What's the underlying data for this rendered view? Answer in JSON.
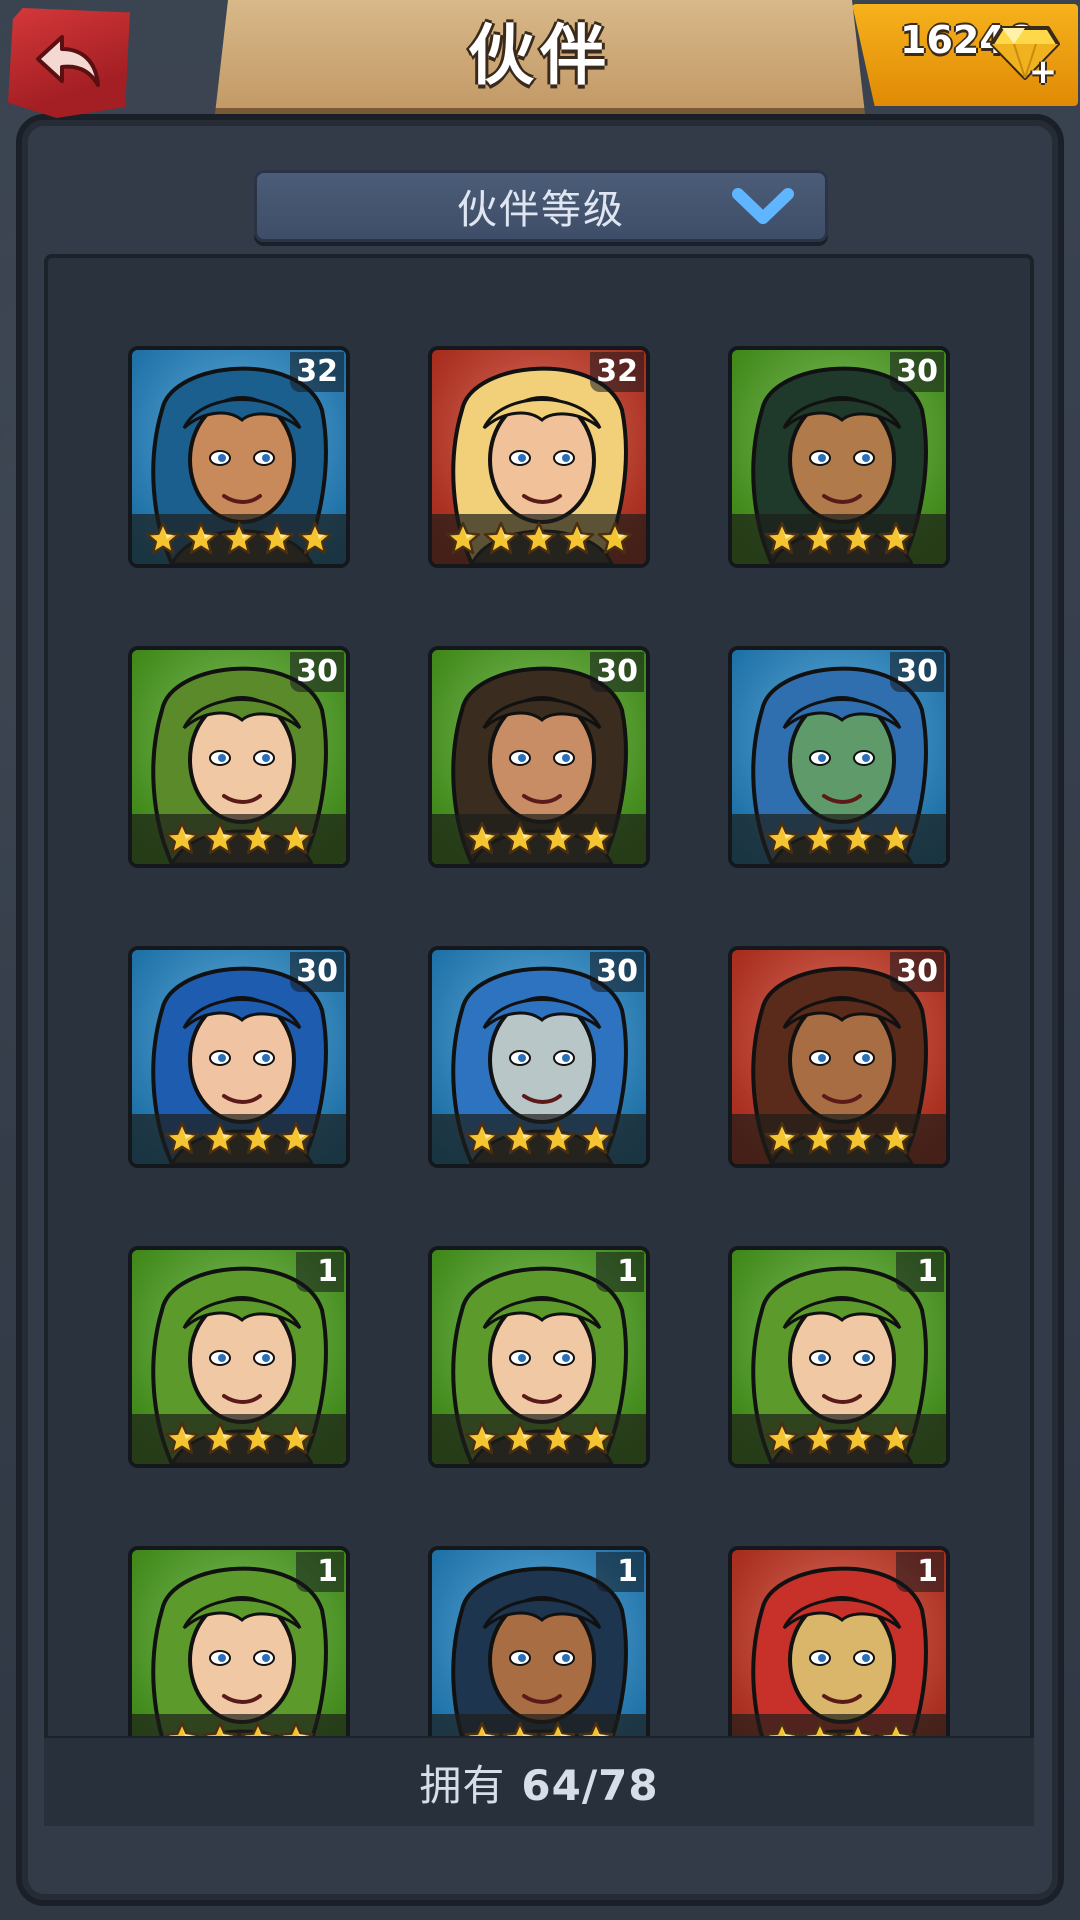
{
  "header": {
    "title": "伙伴",
    "gems": "16246",
    "gem_plus": "+"
  },
  "sort": {
    "label": "伙伴等级"
  },
  "colors": {
    "blue": "#1e8fd8",
    "red": "#d8321c",
    "green": "#4cae18",
    "star": "#f5c431",
    "panel": "#2a323d"
  },
  "companions": [
    {
      "level": "32",
      "stars": 5,
      "bg": "blue",
      "skin": "#c88a5a",
      "hair": "#1b5f8f"
    },
    {
      "level": "32",
      "stars": 5,
      "bg": "red",
      "skin": "#f1c299",
      "hair": "#f2d07a"
    },
    {
      "level": "30",
      "stars": 4,
      "bg": "green",
      "skin": "#b07a4a",
      "hair": "#1f3a2a"
    },
    {
      "level": "30",
      "stars": 4,
      "bg": "green",
      "skin": "#f1c8a4",
      "hair": "#5b8a2a"
    },
    {
      "level": "30",
      "stars": 4,
      "bg": "green",
      "skin": "#c98d66",
      "hair": "#3a2c1e"
    },
    {
      "level": "30",
      "stars": 4,
      "bg": "blue",
      "skin": "#5f9a6a",
      "hair": "#2f6fb0"
    },
    {
      "level": "30",
      "stars": 4,
      "bg": "blue",
      "skin": "#f0c3a3",
      "hair": "#1e5cb0"
    },
    {
      "level": "30",
      "stars": 4,
      "bg": "blue",
      "skin": "#b9c6c8",
      "hair": "#2e73c0"
    },
    {
      "level": "30",
      "stars": 4,
      "bg": "red",
      "skin": "#a86d43",
      "hair": "#5a2a1a"
    },
    {
      "level": "1",
      "stars": 4,
      "bg": "green",
      "skin": "#f0c8a4",
      "hair": "#5c9a2c"
    },
    {
      "level": "1",
      "stars": 4,
      "bg": "green",
      "skin": "#f0c8a4",
      "hair": "#5c9a2c"
    },
    {
      "level": "1",
      "stars": 4,
      "bg": "green",
      "skin": "#f0c8a4",
      "hair": "#5c9a2c"
    },
    {
      "level": "1",
      "stars": 4,
      "bg": "green",
      "skin": "#f0c8a4",
      "hair": "#5c9a2c"
    },
    {
      "level": "1",
      "stars": 4,
      "bg": "blue",
      "skin": "#a86d43",
      "hair": "#1e3550"
    },
    {
      "level": "1",
      "stars": 4,
      "bg": "red",
      "skin": "#d9b66a",
      "hair": "#c8302a"
    }
  ],
  "owned": {
    "label": "拥有",
    "count": "64/78"
  }
}
